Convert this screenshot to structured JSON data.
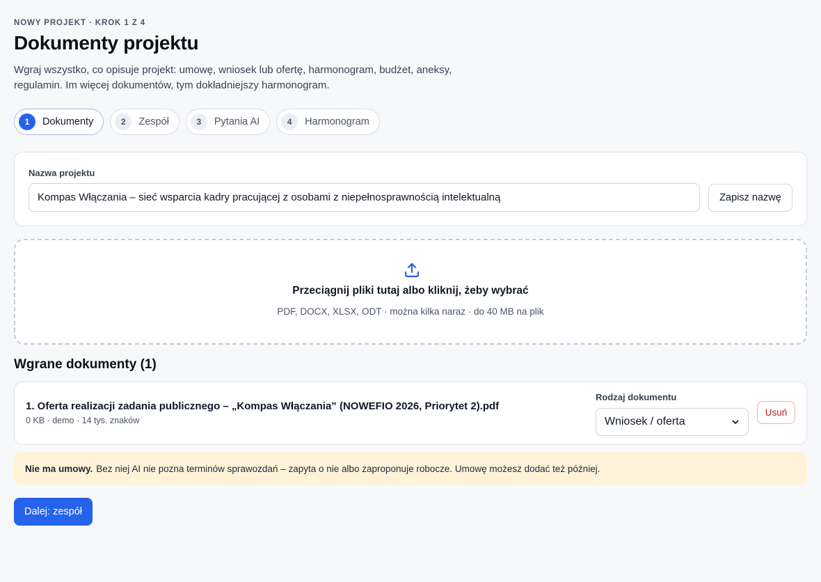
{
  "header": {
    "eyebrow": "NOWY PROJEKT · KROK 1 Z 4",
    "title": "Dokumenty projektu",
    "description": "Wgraj wszystko, co opisuje projekt: umowę, wniosek lub ofertę, harmonogram, budżet, aneksy, regulamin. Im więcej dokumentów, tym dokładniejszy harmonogram."
  },
  "steps": [
    {
      "number": "1",
      "label": "Dokumenty",
      "active": true
    },
    {
      "number": "2",
      "label": "Zespół",
      "active": false
    },
    {
      "number": "3",
      "label": "Pytania AI",
      "active": false
    },
    {
      "number": "4",
      "label": "Harmonogram",
      "active": false
    }
  ],
  "project_name": {
    "label": "Nazwa projektu",
    "value": "Kompas Włączania – sieć wsparcia kadry pracującej z osobami z niepełnosprawnością intelektualną",
    "save_label": "Zapisz nazwę"
  },
  "dropzone": {
    "icon": "upload-icon",
    "title": "Przeciągnij pliki tutaj albo kliknij, żeby wybrać",
    "hint": "PDF, DOCX, XLSX, ODT · można kilka naraz · do 40 MB na plik"
  },
  "uploaded": {
    "title": "Wgrane dokumenty (1)",
    "documents": [
      {
        "name": "1. Oferta realizacji zadania publicznego – „Kompas Włączania” (NOWEFIO 2026, Priorytet 2).pdf",
        "meta": "0 KB · demo · 14 tys. znaków",
        "type_label": "Rodzaj dokumentu",
        "type_value": "Wniosek / oferta",
        "delete_label": "Usuń"
      }
    ]
  },
  "notice": {
    "bold": "Nie ma umowy.",
    "text": "Bez niej AI nie pozna terminów sprawozdań – zapyta o nie albo zaproponuje robocze. Umowę możesz dodać też później."
  },
  "next_button": "Dalej: zespół",
  "colors": {
    "accent": "#2563eb",
    "notice_bg": "#fef3d8",
    "danger": "#b42318"
  }
}
